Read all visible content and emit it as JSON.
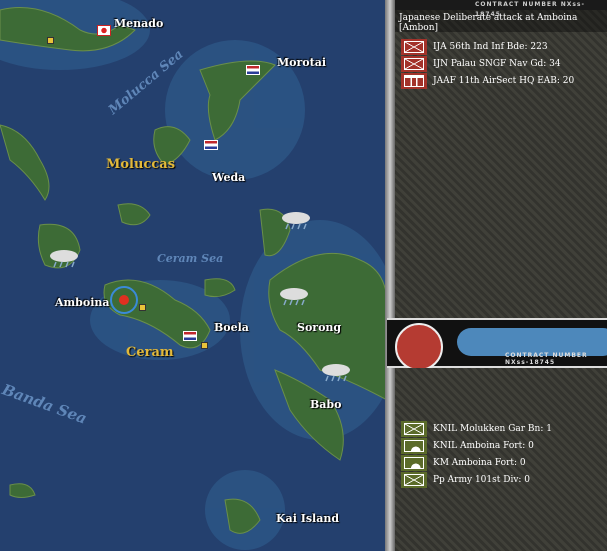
{
  "map": {
    "places": {
      "menado": "Menado",
      "morotai": "Morotai",
      "weda": "Weda",
      "amboina": "Amboina",
      "boela": "Boela",
      "sorong": "Sorong",
      "babo": "Babo",
      "kai": "Kai Island"
    },
    "regions": {
      "moluccas": "Moluccas",
      "ceram": "Ceram"
    },
    "seas": {
      "molucca": "Molucca Sea",
      "ceram": "Ceram Sea",
      "banda": "Banda Sea"
    }
  },
  "combat": {
    "title": "Japanese Deliberate attack at Amboina [Ambon]",
    "strip": "CONTRACT NUMBER  NXss-18745",
    "attackers": [
      {
        "name": "IJA 56th Ind Inf Bde: 223",
        "icon": "infantry"
      },
      {
        "name": "IJN Palau SNGF Nav Gd: 34",
        "icon": "infantry"
      },
      {
        "name": "JAAF 11th AirSect HQ EAB: 20",
        "icon": "hq"
      }
    ],
    "defenders": [
      {
        "name": "KNIL Molukken Gar Bn: 1",
        "icon": "infantry"
      },
      {
        "name": "KNIL Amboina Fort: 0",
        "icon": "fort"
      },
      {
        "name": "KM Amboina Fort: 0",
        "icon": "fort"
      },
      {
        "name": "Pp Army 101st Div: 0",
        "icon": "infantry"
      }
    ],
    "colors": {
      "japan": "#a3322a",
      "allies": "#5b6b2a"
    }
  }
}
